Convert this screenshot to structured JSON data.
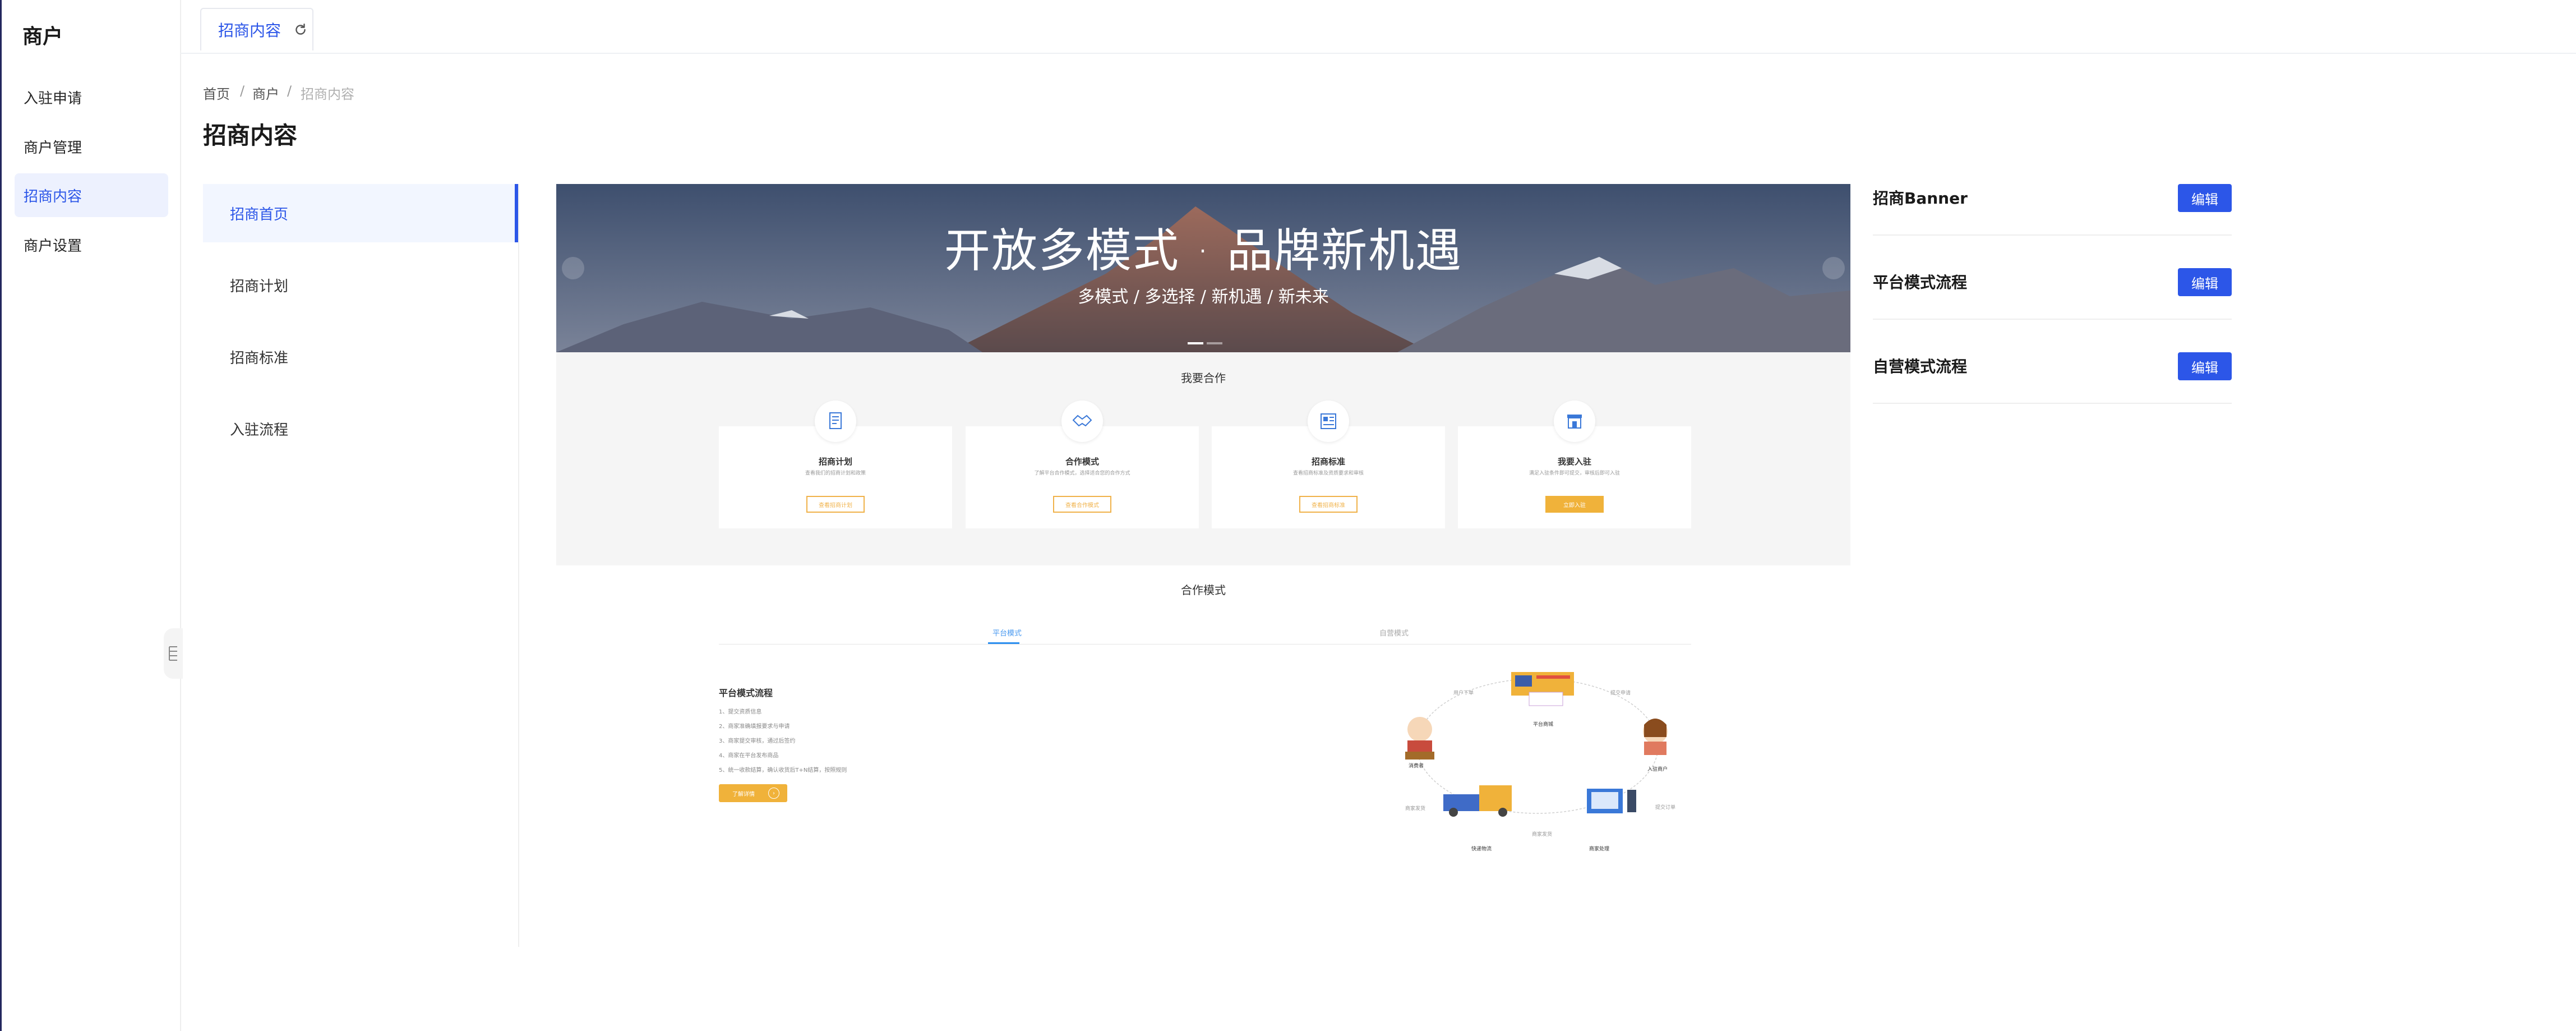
{
  "sidebar": {
    "brand": "商户",
    "items": [
      {
        "label": "入驻申请"
      },
      {
        "label": "商户管理"
      },
      {
        "label": "招商内容"
      },
      {
        "label": "商户设置"
      }
    ],
    "active_index": 2
  },
  "tabbar": {
    "tabs": [
      {
        "label": "招商内容"
      }
    ]
  },
  "breadcrumb": [
    "首页",
    "商户",
    "招商内容"
  ],
  "breadcrumb_separator": "/",
  "page_title": "招商内容",
  "subnav": {
    "items": [
      {
        "label": "招商首页"
      },
      {
        "label": "招商计划"
      },
      {
        "label": "招商标准"
      },
      {
        "label": "入驻流程"
      }
    ],
    "active_index": 0
  },
  "preview": {
    "banner": {
      "title": "开放多模式 · 品牌新机遇",
      "subtitle": "多模式 / 多选择 / 新机遇 / 新未来"
    },
    "cooperate": {
      "heading": "我要合作",
      "cards": [
        {
          "title": "招商计划",
          "desc": "查看我们的招商计划和政策",
          "button": "查看招商计划",
          "icon": "document-icon"
        },
        {
          "title": "合作模式",
          "desc": "了解平台合作模式，选择适合您的合作方式",
          "button": "查看合作模式",
          "icon": "handshake-icon"
        },
        {
          "title": "招商标准",
          "desc": "查看招商标准及资质要求和审核",
          "button": "查看招商标准",
          "icon": "standard-icon"
        },
        {
          "title": "我要入驻",
          "desc": "满足入驻条件即可提交，审核后即可入驻",
          "button": "立即入驻",
          "icon": "store-icon"
        }
      ]
    },
    "mode": {
      "heading": "合作模式",
      "tabs": [
        "平台模式",
        "自营模式"
      ],
      "flow_title": "平台模式流程",
      "steps": [
        "1、提交资质信息",
        "2、商家准确填报要求与申请",
        "3、商家提交审核，通过后签约",
        "4、商家在平台发布商品",
        "5、统一收款结算，确认收货后T+N结算，按照规则"
      ],
      "flow_button": "了解详情",
      "diagram_labels": [
        "用户下单",
        "平台商城",
        "提交申请",
        "消费者",
        "入驻商户",
        "商家发货",
        "快递物流",
        "商家发货",
        "商家处理",
        "提交订单"
      ]
    }
  },
  "right_panel": {
    "rows": [
      {
        "label": "招商Banner",
        "button": "编辑"
      },
      {
        "label": "平台模式流程",
        "button": "编辑"
      },
      {
        "label": "自营模式流程",
        "button": "编辑"
      }
    ]
  },
  "colors": {
    "primary": "#2c56e8",
    "accent_orange": "#f0b23a",
    "sidebar_active_bg": "#edf1fe"
  }
}
